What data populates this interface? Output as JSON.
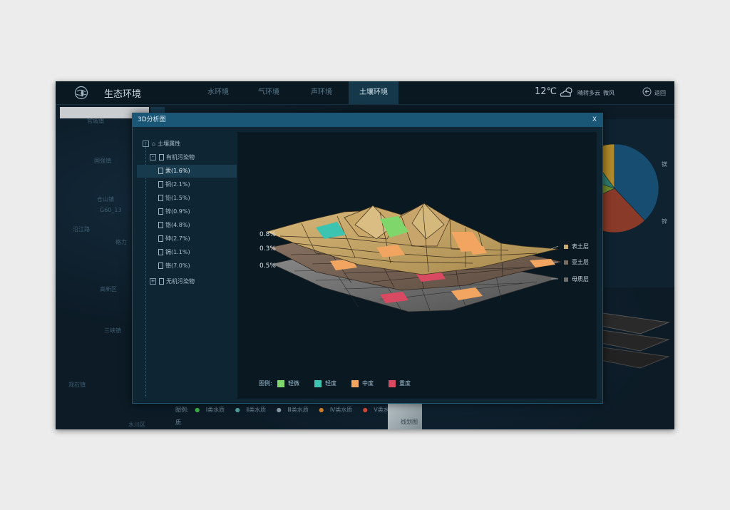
{
  "app": {
    "title": "生态环境",
    "tabs": [
      {
        "label": "水环境",
        "active": false
      },
      {
        "label": "气环境",
        "active": false
      },
      {
        "label": "声环境",
        "active": false
      },
      {
        "label": "土壤环境",
        "active": true
      }
    ],
    "weather": {
      "temp": "12℃",
      "desc": "晴转多云",
      "wind": "微风"
    },
    "back_label": "返回"
  },
  "map": {
    "places": [
      "官城镇",
      "国强镇",
      "仓山镇",
      "G60_13",
      "沿江路",
      "格力",
      "高新区",
      "三峡镇",
      "观石镇",
      "水川区"
    ],
    "legend": {
      "prefix": "图例:",
      "items": [
        "Ⅰ类水质",
        "Ⅱ类水质",
        "Ⅲ类水质",
        "Ⅳ类水质",
        "Ⅴ类水质"
      ],
      "colors": [
        "#3fb24a",
        "#4fa2a0",
        "#8aa0a8",
        "#d8852c",
        "#d84a3a"
      ]
    },
    "thumbnail_label": "线划图",
    "pie": {
      "labels": [
        "镁",
        "锌"
      ],
      "slices": [
        {
          "value": 38,
          "color": "#164d70"
        },
        {
          "value": 30,
          "color": "#8a3a28"
        },
        {
          "value": 12,
          "color": "#6f8a2e"
        },
        {
          "value": 10,
          "color": "#2f7d6e"
        },
        {
          "value": 10,
          "color": "#b08a2a"
        }
      ]
    }
  },
  "modal": {
    "title": "3D分析图",
    "close": "X",
    "tree": {
      "root": "土壤属性",
      "group_organic": "有机污染物",
      "items": [
        "汞(1.6%)",
        "铜(2.1%)",
        "铅(1.5%)",
        "锌(0.9%)",
        "铬(4.8%)",
        "砷(2.7%)",
        "镉(1.1%)",
        "铬(7.0%)"
      ],
      "selected_index": 0,
      "group_inorganic": "无机污染物"
    },
    "depths": [
      "0.8%",
      "0.3%",
      "0.5%"
    ],
    "layers": [
      {
        "name": "表土层",
        "color": "#c9a86b"
      },
      {
        "name": "亚土层",
        "color": "#7a6a5d"
      },
      {
        "name": "母质层",
        "color": "#6d6d6d"
      }
    ],
    "severity": {
      "label": "图例:",
      "items": [
        {
          "name": "轻微",
          "color": "#7fd66a"
        },
        {
          "name": "轻度",
          "color": "#3cc4b0"
        },
        {
          "name": "中度",
          "color": "#f1a561"
        },
        {
          "name": "重度",
          "color": "#d94a62"
        }
      ]
    }
  }
}
